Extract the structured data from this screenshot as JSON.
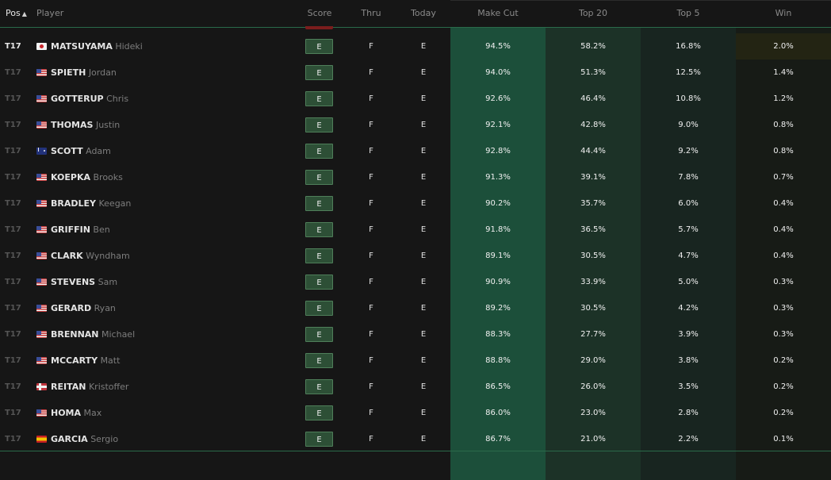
{
  "headers": {
    "pos": "Pos",
    "player": "Player",
    "score": "Score",
    "thru": "Thru",
    "today": "Today",
    "make_cut": "Make Cut",
    "top20": "Top 20",
    "top5": "Top 5",
    "win": "Win"
  },
  "icons": {
    "sort": "sort-icon"
  },
  "colors": {
    "make_cut_bg": "#1c4f3a",
    "top20_bg": "#1c3227",
    "top5_bg": "#182520",
    "score_badge": "#2d4f36"
  },
  "rows": [
    {
      "pos": "T17",
      "flag": "jp",
      "last": "MATSUYAMA",
      "first": "Hideki",
      "score": "E",
      "thru": "F",
      "today": "E",
      "make_cut": "94.5%",
      "top20": "58.2%",
      "top5": "16.8%",
      "win": "2.0%"
    },
    {
      "pos": "T17",
      "flag": "us",
      "last": "SPIETH",
      "first": "Jordan",
      "score": "E",
      "thru": "F",
      "today": "E",
      "make_cut": "94.0%",
      "top20": "51.3%",
      "top5": "12.5%",
      "win": "1.4%"
    },
    {
      "pos": "T17",
      "flag": "us",
      "last": "GOTTERUP",
      "first": "Chris",
      "score": "E",
      "thru": "F",
      "today": "E",
      "make_cut": "92.6%",
      "top20": "46.4%",
      "top5": "10.8%",
      "win": "1.2%"
    },
    {
      "pos": "T17",
      "flag": "us",
      "last": "THOMAS",
      "first": "Justin",
      "score": "E",
      "thru": "F",
      "today": "E",
      "make_cut": "92.1%",
      "top20": "42.8%",
      "top5": "9.0%",
      "win": "0.8%"
    },
    {
      "pos": "T17",
      "flag": "au",
      "last": "SCOTT",
      "first": "Adam",
      "score": "E",
      "thru": "F",
      "today": "E",
      "make_cut": "92.8%",
      "top20": "44.4%",
      "top5": "9.2%",
      "win": "0.8%"
    },
    {
      "pos": "T17",
      "flag": "us",
      "last": "KOEPKA",
      "first": "Brooks",
      "score": "E",
      "thru": "F",
      "today": "E",
      "make_cut": "91.3%",
      "top20": "39.1%",
      "top5": "7.8%",
      "win": "0.7%"
    },
    {
      "pos": "T17",
      "flag": "us",
      "last": "BRADLEY",
      "first": "Keegan",
      "score": "E",
      "thru": "F",
      "today": "E",
      "make_cut": "90.2%",
      "top20": "35.7%",
      "top5": "6.0%",
      "win": "0.4%"
    },
    {
      "pos": "T17",
      "flag": "us",
      "last": "GRIFFIN",
      "first": "Ben",
      "score": "E",
      "thru": "F",
      "today": "E",
      "make_cut": "91.8%",
      "top20": "36.5%",
      "top5": "5.7%",
      "win": "0.4%"
    },
    {
      "pos": "T17",
      "flag": "us",
      "last": "CLARK",
      "first": "Wyndham",
      "score": "E",
      "thru": "F",
      "today": "E",
      "make_cut": "89.1%",
      "top20": "30.5%",
      "top5": "4.7%",
      "win": "0.4%"
    },
    {
      "pos": "T17",
      "flag": "us",
      "last": "STEVENS",
      "first": "Sam",
      "score": "E",
      "thru": "F",
      "today": "E",
      "make_cut": "90.9%",
      "top20": "33.9%",
      "top5": "5.0%",
      "win": "0.3%"
    },
    {
      "pos": "T17",
      "flag": "us",
      "last": "GERARD",
      "first": "Ryan",
      "score": "E",
      "thru": "F",
      "today": "E",
      "make_cut": "89.2%",
      "top20": "30.5%",
      "top5": "4.2%",
      "win": "0.3%"
    },
    {
      "pos": "T17",
      "flag": "us",
      "last": "BRENNAN",
      "first": "Michael",
      "score": "E",
      "thru": "F",
      "today": "E",
      "make_cut": "88.3%",
      "top20": "27.7%",
      "top5": "3.9%",
      "win": "0.3%"
    },
    {
      "pos": "T17",
      "flag": "us",
      "last": "MCCARTY",
      "first": "Matt",
      "score": "E",
      "thru": "F",
      "today": "E",
      "make_cut": "88.8%",
      "top20": "29.0%",
      "top5": "3.8%",
      "win": "0.2%"
    },
    {
      "pos": "T17",
      "flag": "no",
      "last": "REITAN",
      "first": "Kristoffer",
      "score": "E",
      "thru": "F",
      "today": "E",
      "make_cut": "86.5%",
      "top20": "26.0%",
      "top5": "3.5%",
      "win": "0.2%"
    },
    {
      "pos": "T17",
      "flag": "us",
      "last": "HOMA",
      "first": "Max",
      "score": "E",
      "thru": "F",
      "today": "E",
      "make_cut": "86.0%",
      "top20": "23.0%",
      "top5": "2.8%",
      "win": "0.2%"
    },
    {
      "pos": "T17",
      "flag": "es",
      "last": "GARCIA",
      "first": "Sergio",
      "score": "E",
      "thru": "F",
      "today": "E",
      "make_cut": "86.7%",
      "top20": "21.0%",
      "top5": "2.2%",
      "win": "0.1%"
    }
  ]
}
